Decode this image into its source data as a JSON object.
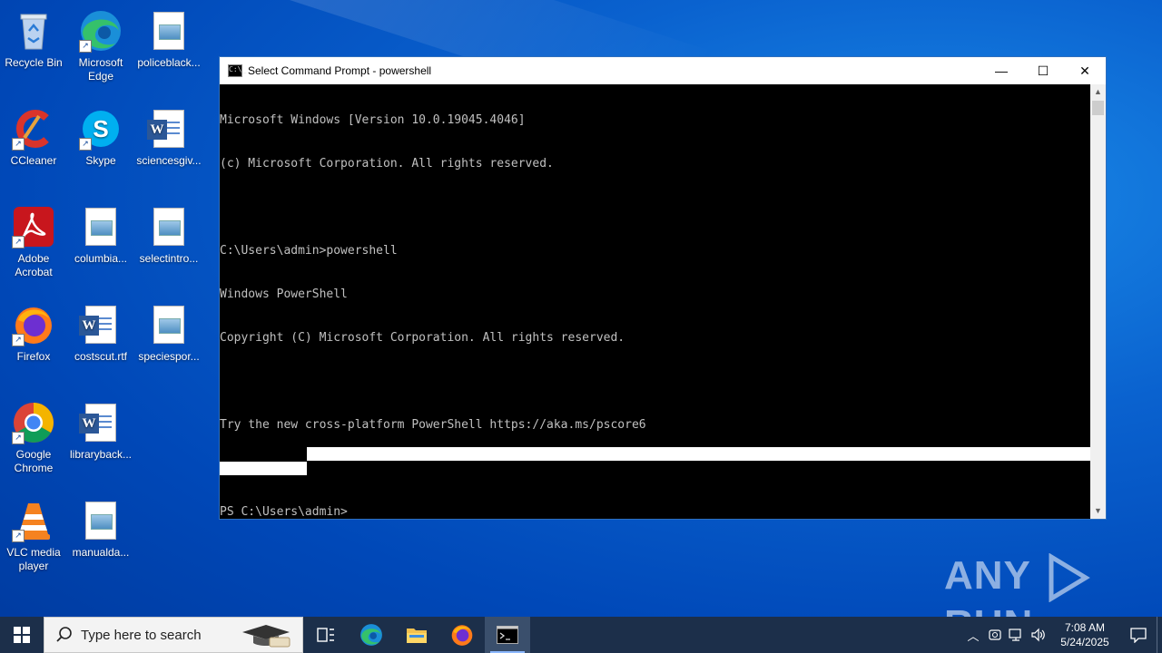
{
  "desktop": {
    "icons": [
      {
        "label": "Recycle Bin",
        "icon": "recycle-bin-icon"
      },
      {
        "label": "Microsoft Edge",
        "icon": "edge-icon"
      },
      {
        "label": "policeblack...",
        "icon": "image-file-icon"
      },
      {
        "label": "CCleaner",
        "icon": "ccleaner-icon"
      },
      {
        "label": "Skype",
        "icon": "skype-icon"
      },
      {
        "label": "sciencesgiv...",
        "icon": "word-file-icon"
      },
      {
        "label": "Adobe Acrobat",
        "icon": "acrobat-icon"
      },
      {
        "label": "columbia...",
        "icon": "image-file-icon"
      },
      {
        "label": "selectintro...",
        "icon": "image-file-icon"
      },
      {
        "label": "Firefox",
        "icon": "firefox-icon"
      },
      {
        "label": "costscut.rtf",
        "icon": "word-file-icon"
      },
      {
        "label": "speciespor...",
        "icon": "image-file-icon"
      },
      {
        "label": "Google Chrome",
        "icon": "chrome-icon"
      },
      {
        "label": "libraryback...",
        "icon": "word-file-icon"
      },
      {
        "label": "VLC media player",
        "icon": "vlc-icon"
      },
      {
        "label": "manualda...",
        "icon": "image-file-icon"
      }
    ]
  },
  "window": {
    "title": "Select Command Prompt - powershell",
    "icon_text": "C:\\_",
    "minimize": "—",
    "maximize": "☐",
    "close": "✕",
    "console_lines": [
      "Microsoft Windows [Version 10.0.19045.4046]",
      "(c) Microsoft Corporation. All rights reserved.",
      "",
      "C:\\Users\\admin>powershell",
      "Windows PowerShell",
      "Copyright (C) Microsoft Corporation. All rights reserved.",
      "",
      "Try the new cross-platform PowerShell https://aka.ms/pscore6",
      "",
      "PS C:\\Users\\admin>"
    ]
  },
  "watermark": {
    "left": "ANY",
    "right": "RUN"
  },
  "taskbar": {
    "search_placeholder": "Type here to search",
    "pinned": [
      "task-view-icon",
      "edge-icon",
      "file-explorer-icon",
      "firefox-icon",
      "cmd-icon"
    ],
    "clock_time": "7:08 AM",
    "clock_date": "5/24/2025"
  },
  "colors": {
    "console_bg": "#000000",
    "console_text": "#c0c0c0",
    "taskbar": "#1c2f4a",
    "desktop": "#0a62cf"
  }
}
